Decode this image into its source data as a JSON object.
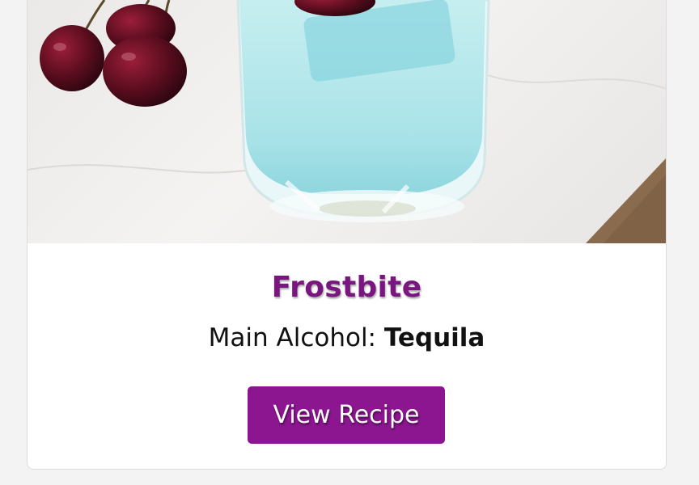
{
  "card": {
    "image_alt": "Frostbite cocktail",
    "title": "Frostbite",
    "meta_label": "Main Alcohol:",
    "meta_value": "Tequila",
    "button_label": "View Recipe"
  },
  "colors": {
    "title": "#7a167f",
    "button": "#8b168f",
    "page_background": "#f3f3f4",
    "card_background": "#ffffff"
  }
}
